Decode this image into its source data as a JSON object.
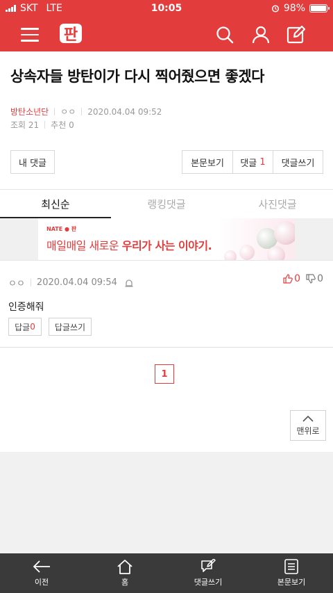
{
  "status_bar": {
    "carrier": "SKT",
    "network": "LTE",
    "time": "10:05",
    "battery": "98%",
    "battery_level": 0.98
  },
  "app_bar": {
    "logo_text": "판",
    "icons": [
      "hamburger-menu-icon",
      "search-icon",
      "user-icon",
      "edit-icon"
    ]
  },
  "post": {
    "title": "상속자들 방탄이가 다시 찍어줬으면 좋겠다",
    "category": "방탄소년단",
    "author": "ㅇㅇ",
    "date": "2020.04.04 09:52",
    "views": "조회 21",
    "recommend": "추천 0"
  },
  "actions": {
    "my_comments": "내 댓글",
    "view_post": "본문보기",
    "comments_label": "댓글",
    "comments_count": "1",
    "write_comment": "댓글쓰기"
  },
  "tabs": [
    {
      "label": "최신순",
      "active": true
    },
    {
      "label": "랭킹댓글",
      "active": false
    },
    {
      "label": "사진댓글",
      "active": false
    }
  ],
  "ad": {
    "brand": "NATE ● 판",
    "slogan_plain": "매일매일 새로운 ",
    "slogan_bold": "우리가 사는 이야기."
  },
  "comment": {
    "author": "ㅇㅇ",
    "date": "2020.04.04 09:54",
    "up": "0",
    "down": "0",
    "text": "인증해줘",
    "reply_label": "답글",
    "reply_count": "0",
    "write_reply": "답글쓰기"
  },
  "pagination": {
    "current": "1"
  },
  "to_top": "맨위로",
  "bottom_nav": [
    {
      "label": "이전",
      "icon": "back-arrow-icon"
    },
    {
      "label": "홈",
      "icon": "home-icon"
    },
    {
      "label": "댓글쓰기",
      "icon": "write-comment-icon"
    },
    {
      "label": "본문보기",
      "icon": "document-icon"
    }
  ],
  "colors": {
    "brand_red": "#e23c3c",
    "bottom_bar": "#3a3a3a"
  }
}
